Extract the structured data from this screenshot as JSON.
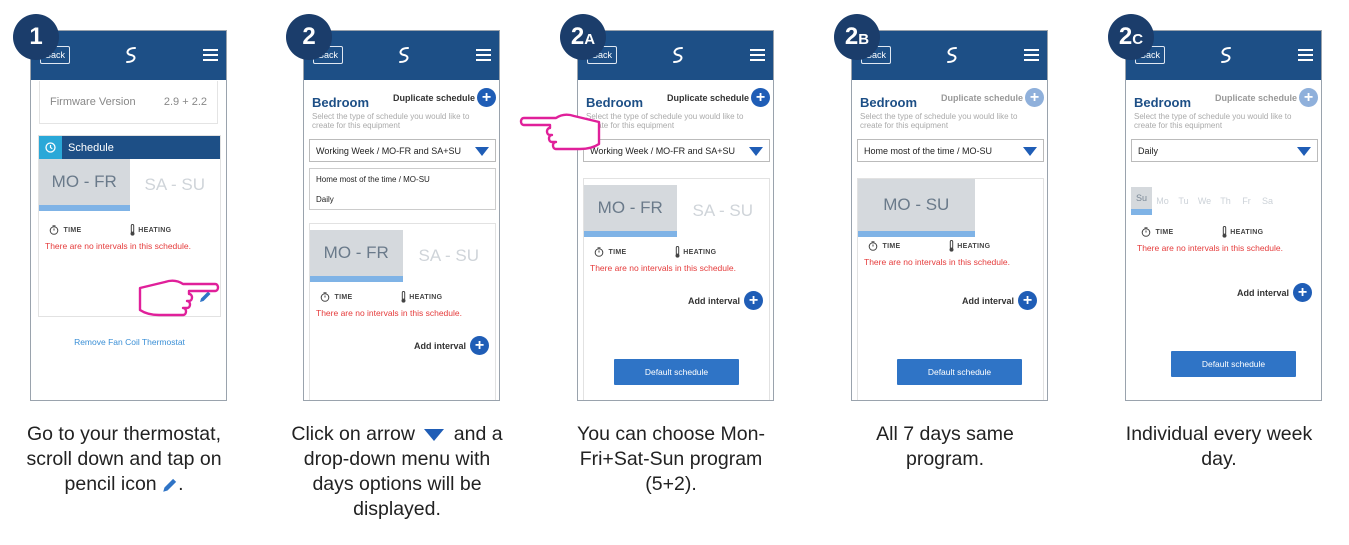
{
  "colors": {
    "brand": "#1d4f86",
    "badge": "#1b3d6b",
    "accent": "#1f5db6",
    "error": "#e53b3b",
    "hand": "#e0209a"
  },
  "common": {
    "back_label": "Back",
    "time_label": "TIME",
    "heating_label": "HEATING",
    "no_intervals": "There are no intervals in this schedule.",
    "bedroom": "Bedroom",
    "duplicate_label": "Duplicate schedule",
    "hint": "Select the type of schedule you would like to create for this equipment",
    "add_interval": "Add interval",
    "default_schedule": "Default schedule",
    "mo_fr": "MO - FR",
    "sa_su": "SA - SU",
    "mo_su": "MO - SU"
  },
  "steps": [
    {
      "badge": "1",
      "badge_sub": "",
      "firmware_label": "Firmware Version",
      "firmware_value": "2.9 + 2.2",
      "schedule_title": "Schedule",
      "remove_label": "Remove Fan Coil Thermostat",
      "caption_a": "Go to your thermostat, scroll down and tap on pencil icon",
      "caption_b": "."
    },
    {
      "badge": "2",
      "badge_sub": "",
      "select_value": "Working Week / MO-FR and SA+SU",
      "options": [
        "Home most of the time / MO-SU",
        "Daily"
      ],
      "caption_a": "Click on arrow",
      "caption_b": "and a drop-down menu with days options will be displayed."
    },
    {
      "badge": "2",
      "badge_sub": "A",
      "select_value": "Working Week / MO-FR and SA+SU",
      "caption": "You can choose Mon-Fri+Sat-Sun program (5+2)."
    },
    {
      "badge": "2",
      "badge_sub": "B",
      "select_value": "Home most of the time / MO-SU",
      "caption": "All 7 days same program."
    },
    {
      "badge": "2",
      "badge_sub": "C",
      "select_value": "Daily",
      "days": [
        "Su",
        "Mo",
        "Tu",
        "We",
        "Th",
        "Fr",
        "Sa"
      ],
      "caption": "Individual every week day."
    }
  ]
}
